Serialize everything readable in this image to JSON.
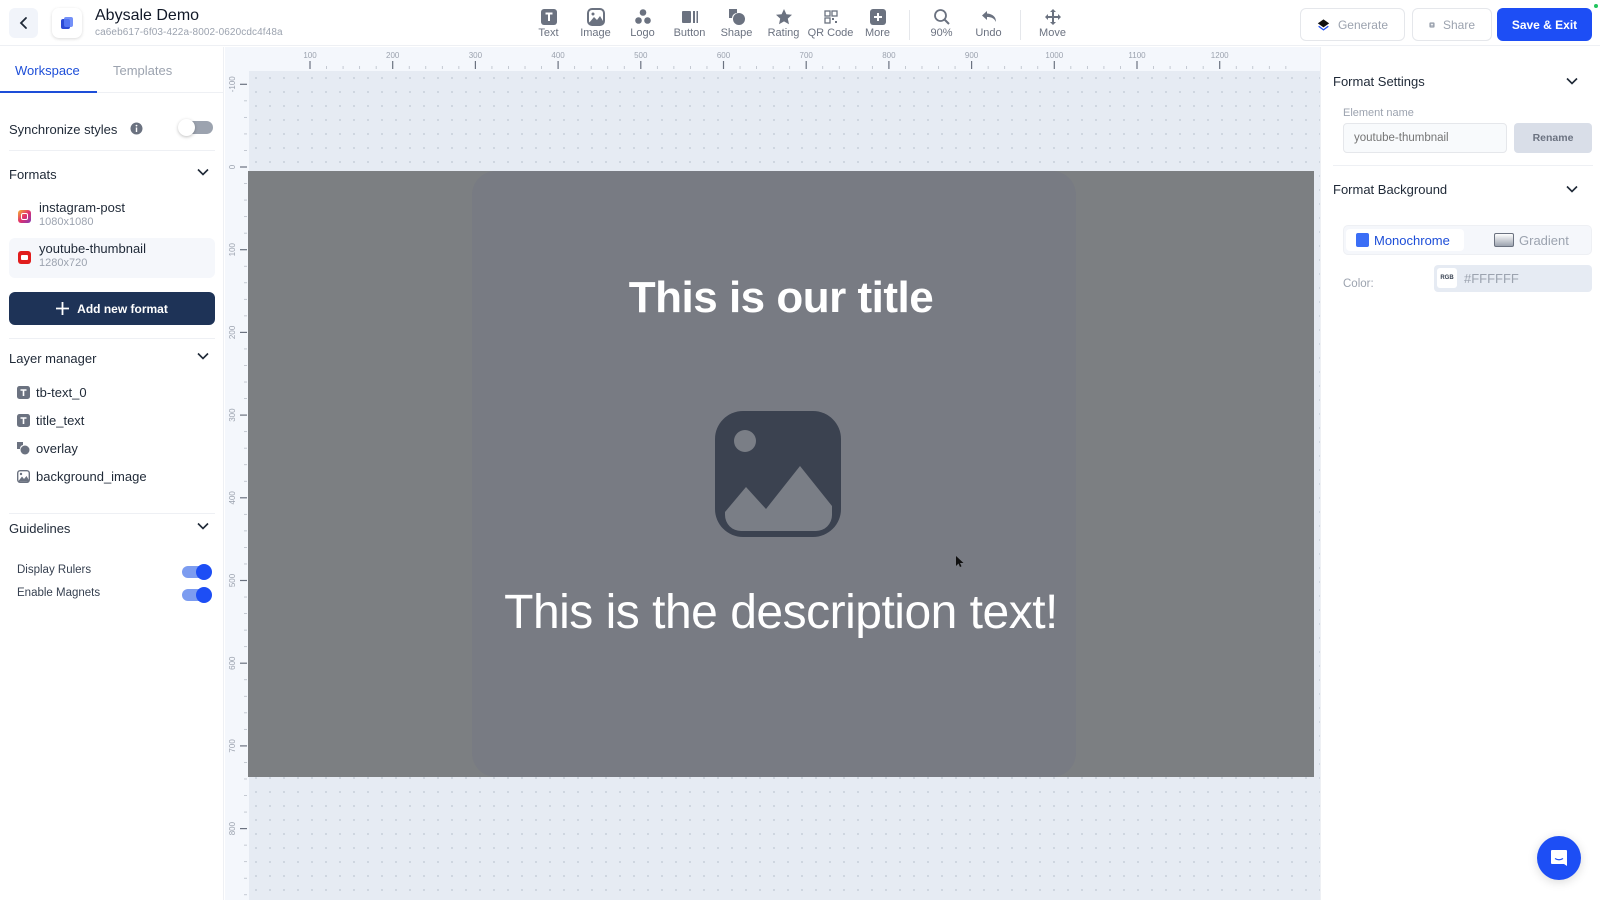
{
  "header": {
    "title": "Abysale Demo",
    "project_id": "ca6eb617-6f03-422a-8002-0620cdc4f48a",
    "tools": [
      {
        "label": "Text",
        "icon": "text-icon"
      },
      {
        "label": "Image",
        "icon": "image-icon"
      },
      {
        "label": "Logo",
        "icon": "logo-icon"
      },
      {
        "label": "Button",
        "icon": "button-icon"
      },
      {
        "label": "Shape",
        "icon": "shape-icon"
      },
      {
        "label": "Rating",
        "icon": "star-icon"
      },
      {
        "label": "QR Code",
        "icon": "qr-code-icon"
      },
      {
        "label": "More",
        "icon": "plus-icon"
      }
    ],
    "zoom_label": "90%",
    "undo_label": "Undo",
    "move_label": "Move",
    "generate_label": "Generate",
    "share_label": "Share",
    "save_label": "Save & Exit"
  },
  "sidebar": {
    "tabs": [
      {
        "label": "Workspace",
        "active": true
      },
      {
        "label": "Templates",
        "active": false
      }
    ],
    "sync_styles_label": "Synchronize styles",
    "sync_styles_on": false,
    "formats_title": "Formats",
    "formats": [
      {
        "name": "instagram-post",
        "size": "1080x1080",
        "icon": "instagram-icon",
        "selected": false
      },
      {
        "name": "youtube-thumbnail",
        "size": "1280x720",
        "icon": "youtube-icon",
        "selected": true
      }
    ],
    "add_format_label": "Add new format",
    "layers_title": "Layer manager",
    "layers": [
      {
        "name": "tb-text_0",
        "icon": "text-layer-icon"
      },
      {
        "name": "title_text",
        "icon": "text-layer-icon"
      },
      {
        "name": "overlay",
        "icon": "shape-layer-icon"
      },
      {
        "name": "background_image",
        "icon": "image-layer-icon"
      }
    ],
    "guidelines_title": "Guidelines",
    "guidelines": [
      {
        "label": "Display Rulers",
        "on": true
      },
      {
        "label": "Enable Magnets",
        "on": true
      }
    ]
  },
  "canvas": {
    "ruler_top_labels": [
      "100",
      "200",
      "300",
      "400",
      "500",
      "600",
      "700",
      "800",
      "900",
      "1000",
      "1100",
      "1200"
    ],
    "ruler_left_labels": [
      "-100",
      "0",
      "100",
      "200",
      "300",
      "400",
      "500",
      "600",
      "700",
      "800"
    ],
    "title_text": "This is our title",
    "description_text": "This is the description text!"
  },
  "right_panel": {
    "format_settings_title": "Format Settings",
    "element_name_label": "Element name",
    "element_name_placeholder": "youtube-thumbnail",
    "rename_label": "Rename",
    "format_background_title": "Format Background",
    "bg_modes": [
      {
        "label": "Monochrome",
        "active": true
      },
      {
        "label": "Gradient",
        "active": false
      }
    ],
    "color_label": "Color:",
    "color_format": "RGB",
    "color_value": "#FFFFFF"
  },
  "colors": {
    "accent": "#1D4EF5",
    "dark_button": "#1E3357",
    "artboard_bg": "#7C7F82"
  }
}
